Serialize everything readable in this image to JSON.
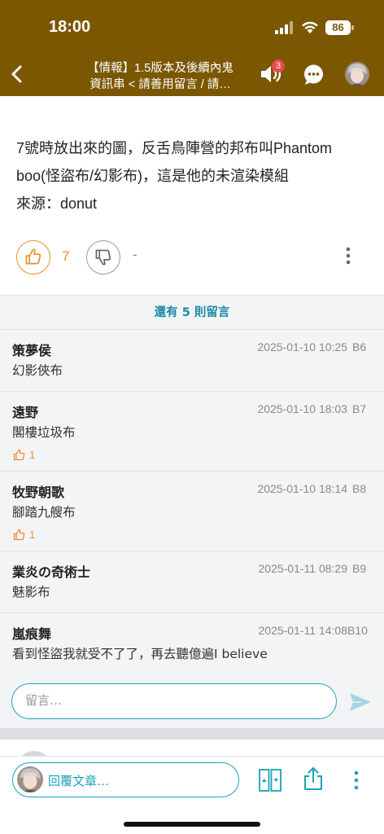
{
  "status_bar": {
    "time": "18:00",
    "battery": "86"
  },
  "nav": {
    "title_line1": "【情報】1.5版本及後續內鬼",
    "title_line2": "資訊串 < 請善用留言 / 請…",
    "notification_count": "3"
  },
  "post": {
    "lines": [
      "7號時放出來的圖，反舌鳥陣營的邦布叫Phantom",
      "boo(怪盜布/幻影布)，這是他的未渲染模組",
      "來源：donut"
    ],
    "likes": "7",
    "dislikes": "-"
  },
  "comments_section": {
    "more_label": "還有 5 則留言",
    "comments": [
      {
        "author": "策夢侯",
        "time": "2025-01-10 10:25",
        "floor": "B6",
        "text": "幻影俠布",
        "likes": ""
      },
      {
        "author": "遠野",
        "time": "2025-01-10 18:03",
        "floor": "B7",
        "text": "閣樓垃圾布",
        "likes": "1"
      },
      {
        "author": "牧野朝歌",
        "time": "2025-01-10 18:14",
        "floor": "B8",
        "text": "腳踏九艘布",
        "likes": "1"
      },
      {
        "author": "業炎の奇術士",
        "time": "2025-01-11 08:29",
        "floor": "B9",
        "text": "魅影布",
        "likes": ""
      },
      {
        "author": "嵐痕舞",
        "time": "2025-01-11 14:08",
        "floor": "B10",
        "text": "看到怪盜我就受不了了，再去聽億遍I believe",
        "likes": ""
      }
    ],
    "input_placeholder": "留言…"
  },
  "bottom_bar": {
    "reply_placeholder": "回覆文章…"
  },
  "colors": {
    "brand": "#7a5700",
    "accent": "#1aa3b8",
    "like": "#e8922e",
    "link": "#1a8aa6"
  },
  "icons": [
    "back-icon",
    "speaker-icon",
    "chat-icon",
    "thumbs-up-icon",
    "thumbs-down-icon",
    "more-vertical-icon",
    "send-icon",
    "floor-jump-icon",
    "share-icon"
  ]
}
